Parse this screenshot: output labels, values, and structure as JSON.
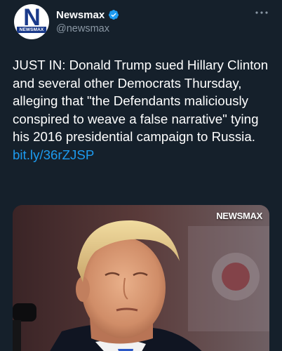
{
  "account": {
    "display_name": "Newsmax",
    "handle": "@newsmax",
    "avatar_letter": "N",
    "avatar_brand": "NEWSMAX",
    "verified": true
  },
  "tweet": {
    "text": "JUST IN: Donald Trump sued Hillary Clinton and several other Democrats Thursday, alleging that \"the Defendants maliciously conspired to weave a false narrative\" tying his 2016 presidential campaign to Russia. ",
    "link_text": "bit.ly/36rZJSP"
  },
  "media": {
    "watermark": "NEWSMAX",
    "description_icon": "photo"
  },
  "icons": {
    "more": "more-options-icon",
    "verified": "verified-badge-icon"
  },
  "colors": {
    "background": "#15202b",
    "link": "#1d9bf0",
    "secondary_text": "#8b98a5",
    "verified": "#1d9bf0"
  }
}
